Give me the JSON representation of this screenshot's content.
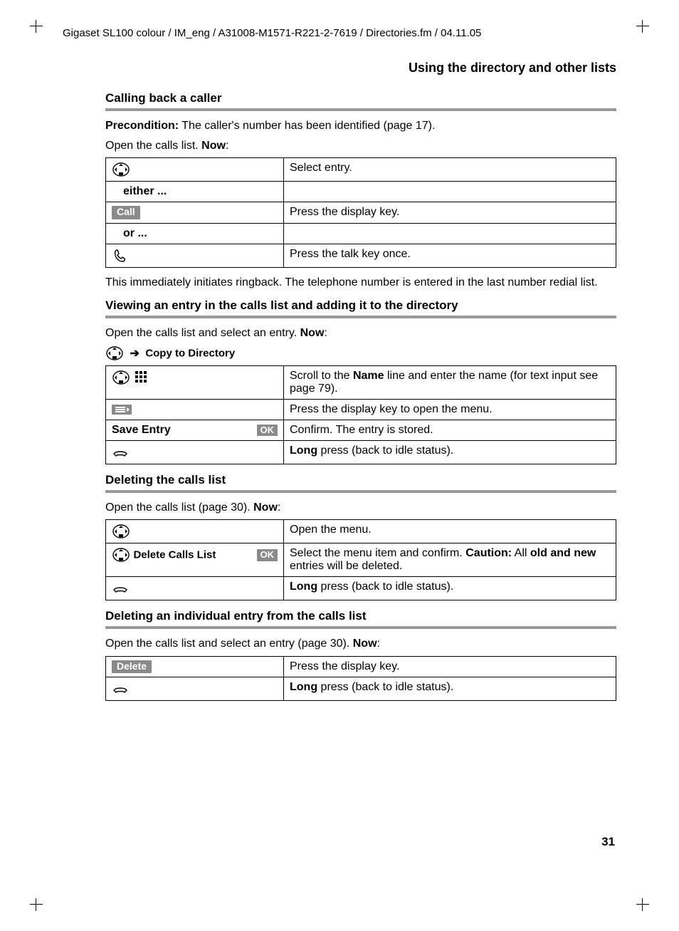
{
  "header_line": "Gigaset SL100 colour / IM_eng / A31008-M1571-R221-2-7619 / Directories.fm / 04.11.05",
  "page_title": "Using the directory and other lists",
  "section1": {
    "heading": "Calling back a caller",
    "pre_label": "Precondition:",
    "pre_text": " The caller's number has been identified (page 17).",
    "open_text": "Open the calls list. ",
    "now": "Now",
    "colon": ":",
    "rows": {
      "select": "Select entry.",
      "either": "either ...",
      "call_key": "Call",
      "call_desc": "Press the display key.",
      "or": "or ...",
      "talk_desc": "Press the talk key once."
    },
    "after": "This immediately initiates ringback. The telephone number is entered in the last number redial list."
  },
  "section2": {
    "heading": "Viewing an entry in the calls list and adding it to the directory",
    "open_text": "Open the calls list and select an entry. ",
    "now": "Now",
    "colon": ":",
    "menu_path": "Copy to Directory",
    "rows": {
      "scroll_pre": "Scroll to the ",
      "scroll_bold": "Name",
      "scroll_post": " line and enter the name (for text input see page 79).",
      "menu_desc": "Press the display key to open the menu.",
      "save_label": "Save Entry",
      "ok_key": "OK",
      "save_desc": "Confirm. The entry is stored.",
      "long_bold": "Long",
      "long_post": " press (back to idle status)."
    }
  },
  "section3": {
    "heading": "Deleting the calls list",
    "open_text": "Open the calls list (page 30). ",
    "now": "Now",
    "colon": ":",
    "rows": {
      "open_menu": "Open the menu.",
      "delete_label": "Delete Calls List",
      "ok_key": "OK",
      "confirm_pre": "Select the menu item and confirm. ",
      "caution_bold": "Caution:",
      "confirm_mid": " All ",
      "old_new_bold": "old and new",
      "confirm_post": " entries will be deleted.",
      "long_bold": "Long",
      "long_post": " press (back to idle status)."
    }
  },
  "section4": {
    "heading": "Deleting an individual entry from the calls list",
    "open_text": "Open the calls list and select an entry (page 30). ",
    "now": "Now",
    "colon": ":",
    "rows": {
      "delete_key": "Delete",
      "delete_desc": "Press the display key.",
      "long_bold": "Long",
      "long_post": " press (back to idle status)."
    }
  },
  "page_number": "31"
}
